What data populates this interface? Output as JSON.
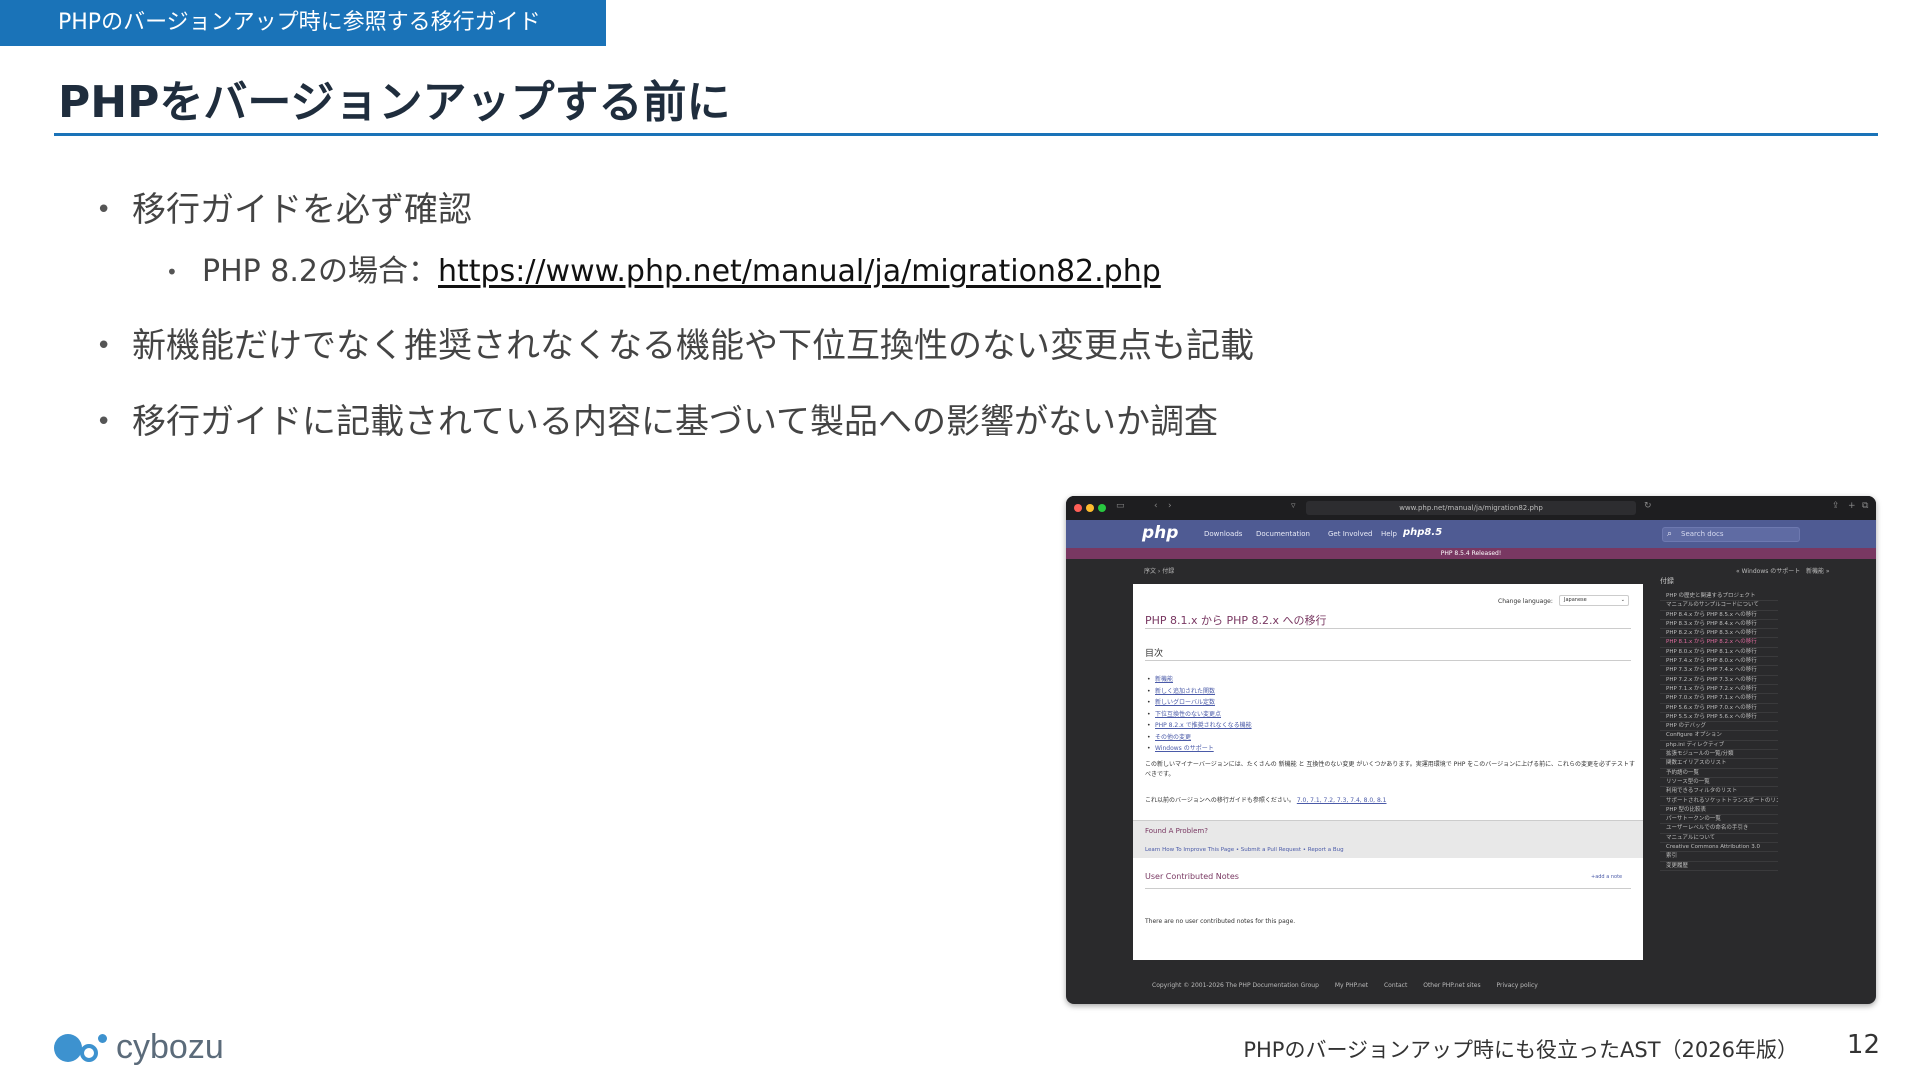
{
  "section_tag": "PHPのバージョンアップ時に参照する移行ガイド",
  "title": "PHPをバージョンアップする前に",
  "bullets": {
    "b1": "移行ガイドを必ず確認",
    "b1_sub_prefix": "PHP 8.2の場合：",
    "b1_sub_url": "https://www.php.net/manual/ja/migration82.php",
    "b2": "新機能だけでなく推奨されなくなる機能や下位互換性のない変更点も記載",
    "b3": "移行ガイドに記載されている内容に基づいて製品への影響がないか調査"
  },
  "footer": {
    "logo_text": "cybozu",
    "note": "PHPのバージョンアップ時にも役立ったAST（2026年版）",
    "page": "12"
  },
  "colors": {
    "accent": "#1a73b8",
    "php_nav": "#4f5b93",
    "php_banner": "#793862"
  },
  "screenshot": {
    "address": "www.php.net/manual/ja/migration82.php",
    "nav_logo": "php",
    "nav": {
      "downloads": "Downloads",
      "documentation": "Documentation",
      "get_involved": "Get Involved",
      "help": "Help",
      "brand": "php8.5"
    },
    "search_placeholder": "Search docs",
    "banner": "PHP 8.5.4 Released!",
    "breadcrumb": "序文 › 付録",
    "breadcrumb_right1": "« Windows のサポート",
    "breadcrumb_right2": "新機能 »",
    "change_language_label": "Change language:",
    "language_value": "Japanese",
    "heading": "PHP 8.1.x から PHP 8.2.x への移行",
    "toc_title": "目次",
    "toc": [
      "新機能",
      "新しく追加された関数",
      "新しいグローバル定数",
      "下位互換性のない変更点",
      "PHP 8.2.x で推奨されなくなる機能",
      "その他の変更",
      "Windows のサポート"
    ],
    "intro": "この新しいマイナーバージョンには、たくさんの 新機能 と 互換性のない変更 がいくつかあります。実運用環境で PHP をこのバージョンに上げる前に、これらの変更を必ずテストすべきです。",
    "also_prefix": "これ以前のバージョンへの移行ガイドも参照ください。",
    "also_links": "7.0, 7.1, 7.2, 7.3, 7.4, 8.0, 8.1",
    "found_problem": "Found A Problem?",
    "found_links": "Learn How To Improve This Page • Submit a Pull Request • Report a Bug",
    "ucn_title": "User Contributed Notes",
    "add_note": "+add a note",
    "no_notes": "There are no user contributed notes for this page.",
    "side_title": "付録",
    "side_items": [
      "PHP の歴史と関連するプロジェクト",
      "マニュアルのサンプルコードについて",
      "PHP 8.4.x から PHP 8.5.x への移行",
      "PHP 8.3.x から PHP 8.4.x への移行",
      "PHP 8.2.x から PHP 8.3.x への移行",
      "PHP 8.1.x から PHP 8.2.x への移行",
      "PHP 8.0.x から PHP 8.1.x への移行",
      "PHP 7.4.x から PHP 8.0.x への移行",
      "PHP 7.3.x から PHP 7.4.x への移行",
      "PHP 7.2.x から PHP 7.3.x への移行",
      "PHP 7.1.x から PHP 7.2.x への移行",
      "PHP 7.0.x から PHP 7.1.x への移行",
      "PHP 5.6.x から PHP 7.0.x への移行",
      "PHP 5.5.x から PHP 5.6.x への移行",
      "PHP のデバッグ",
      "Configure オプション",
      "php.ini ディレクティブ",
      "拡張モジュールの一覧/分類",
      "関数エイリアスのリスト",
      "予約語の一覧",
      "リソース型の一覧",
      "利用できるフィルタのリスト",
      "サポートされるソケットトランスポートのリスト",
      "PHP 型の比較表",
      "パーサトークンの一覧",
      "ユーザーレベルでの命名の手引き",
      "マニュアルについて",
      "Creative Commons Attribution 3.0",
      "索引",
      "変更履歴"
    ],
    "footer_links": [
      "Copyright © 2001-2026 The PHP Documentation Group",
      "My PHP.net",
      "Contact",
      "Other PHP.net sites",
      "Privacy policy"
    ]
  }
}
